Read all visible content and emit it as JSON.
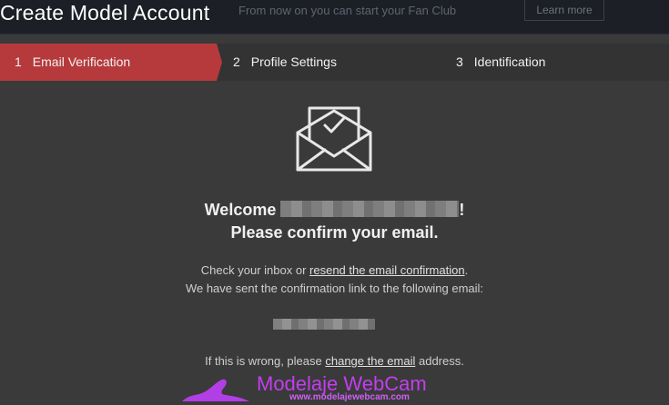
{
  "header": {
    "title": "Create Model Account",
    "subtitle": "From now on you can start your Fan Club",
    "learn_more": "Learn more"
  },
  "steps": [
    {
      "num": "1",
      "label": "Email Verification",
      "active": true
    },
    {
      "num": "2",
      "label": "Profile Settings",
      "active": false
    },
    {
      "num": "3",
      "label": "Identification",
      "active": false
    }
  ],
  "main": {
    "welcome_prefix": "Welcome",
    "welcome_suffix": "!",
    "confirm_heading": "Please confirm your email.",
    "inbox_prefix": "Check your inbox or ",
    "resend_link": "resend the email confirmation",
    "inbox_suffix": ".",
    "sent_text": "We have sent the confirmation link to the following email:",
    "wrong_prefix": "If this is wrong, please ",
    "change_link": "change the email",
    "wrong_suffix": " address."
  },
  "watermark": {
    "brand": "Modelaje WebCam",
    "url": "www.modelajewebcam.com"
  },
  "colors": {
    "active_step": "#b63a3c",
    "background": "#3a3a3a",
    "topbar": "#1c1f26",
    "watermark": "#c43df0"
  },
  "icons": {
    "envelope": "envelope-check-icon"
  }
}
